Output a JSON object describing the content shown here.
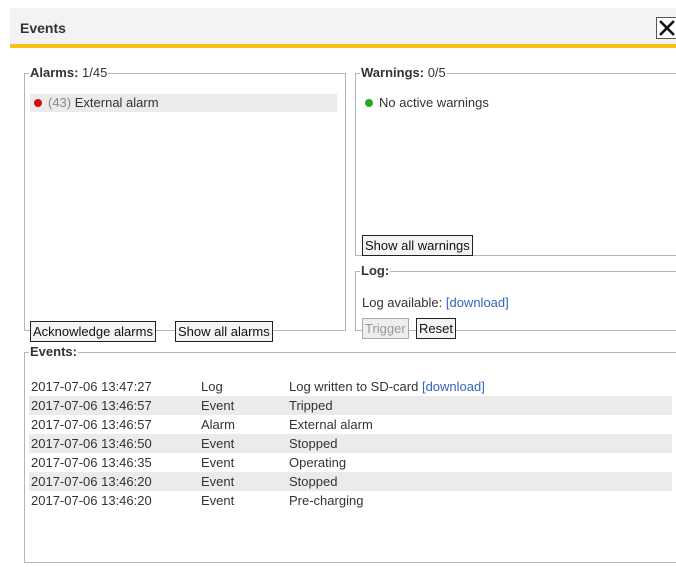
{
  "dialog": {
    "title": "Events",
    "close_label": "close"
  },
  "alarms": {
    "legend_title": "Alarms:",
    "legend_count": "1/45",
    "items": [
      {
        "code": "(43)",
        "text": "External alarm",
        "status_color": "#cc1111"
      }
    ],
    "acknowledge_label": "Acknowledge alarms",
    "show_all_label": "Show all alarms"
  },
  "warnings": {
    "legend_title": "Warnings:",
    "legend_count": "0/5",
    "status_text": "No active warnings",
    "status_color": "#22aa22",
    "show_all_label": "Show all warnings"
  },
  "log": {
    "legend_title": "Log:",
    "available_label": "Log available:",
    "download_link": "[download]",
    "trigger_label": "Trigger",
    "reset_label": "Reset"
  },
  "events": {
    "legend_title": "Events:",
    "rows": [
      {
        "time": "2017-07-06 13:47:27",
        "type": "Log",
        "message": "Log written to SD-card",
        "link": "[download]"
      },
      {
        "time": "2017-07-06 13:46:57",
        "type": "Event",
        "message": "Tripped",
        "link": ""
      },
      {
        "time": "2017-07-06 13:46:57",
        "type": "Alarm",
        "message": "External alarm",
        "link": ""
      },
      {
        "time": "2017-07-06 13:46:50",
        "type": "Event",
        "message": "Stopped",
        "link": ""
      },
      {
        "time": "2017-07-06 13:46:35",
        "type": "Event",
        "message": "Operating",
        "link": ""
      },
      {
        "time": "2017-07-06 13:46:20",
        "type": "Event",
        "message": "Stopped",
        "link": ""
      },
      {
        "time": "2017-07-06 13:46:20",
        "type": "Event",
        "message": "Pre-charging",
        "link": ""
      }
    ]
  },
  "colors": {
    "accent": "#f5c313",
    "link": "#3366bb",
    "alarm": "#cc1111",
    "ok": "#22aa22"
  }
}
